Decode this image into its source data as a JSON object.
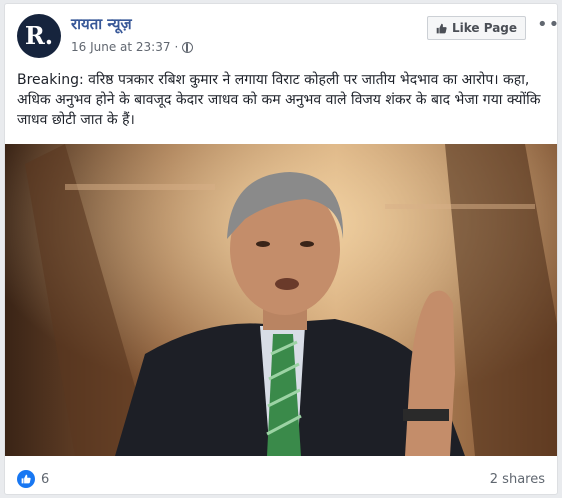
{
  "post": {
    "avatar_text": "R.",
    "page_name": "रायता न्यूज़",
    "timestamp": "16 June at 23:37",
    "separator": "·",
    "like_page_label": "Like Page",
    "more_label": "•••",
    "text": "Breaking: वरिष्ठ पत्रकार रबिश कुमार ने लगाया विराट कोहली पर जातीय भेदभाव का आरोप। कहा, अधिक अनुभव होने के बावजूद केदार जाधव को कम अनुभव वाले विजय शंकर के बाद भेजा गया क्योंकि जाधव छोटी जात के हैं।",
    "reaction_count": "6",
    "shares": "2 shares"
  },
  "icons": {
    "globe": "globe-icon",
    "like": "thumbs-up-icon",
    "more": "ellipsis-icon"
  },
  "colors": {
    "page_name": "#385898",
    "like_reaction": "#1877f2",
    "avatar_bg": "#16243d"
  }
}
